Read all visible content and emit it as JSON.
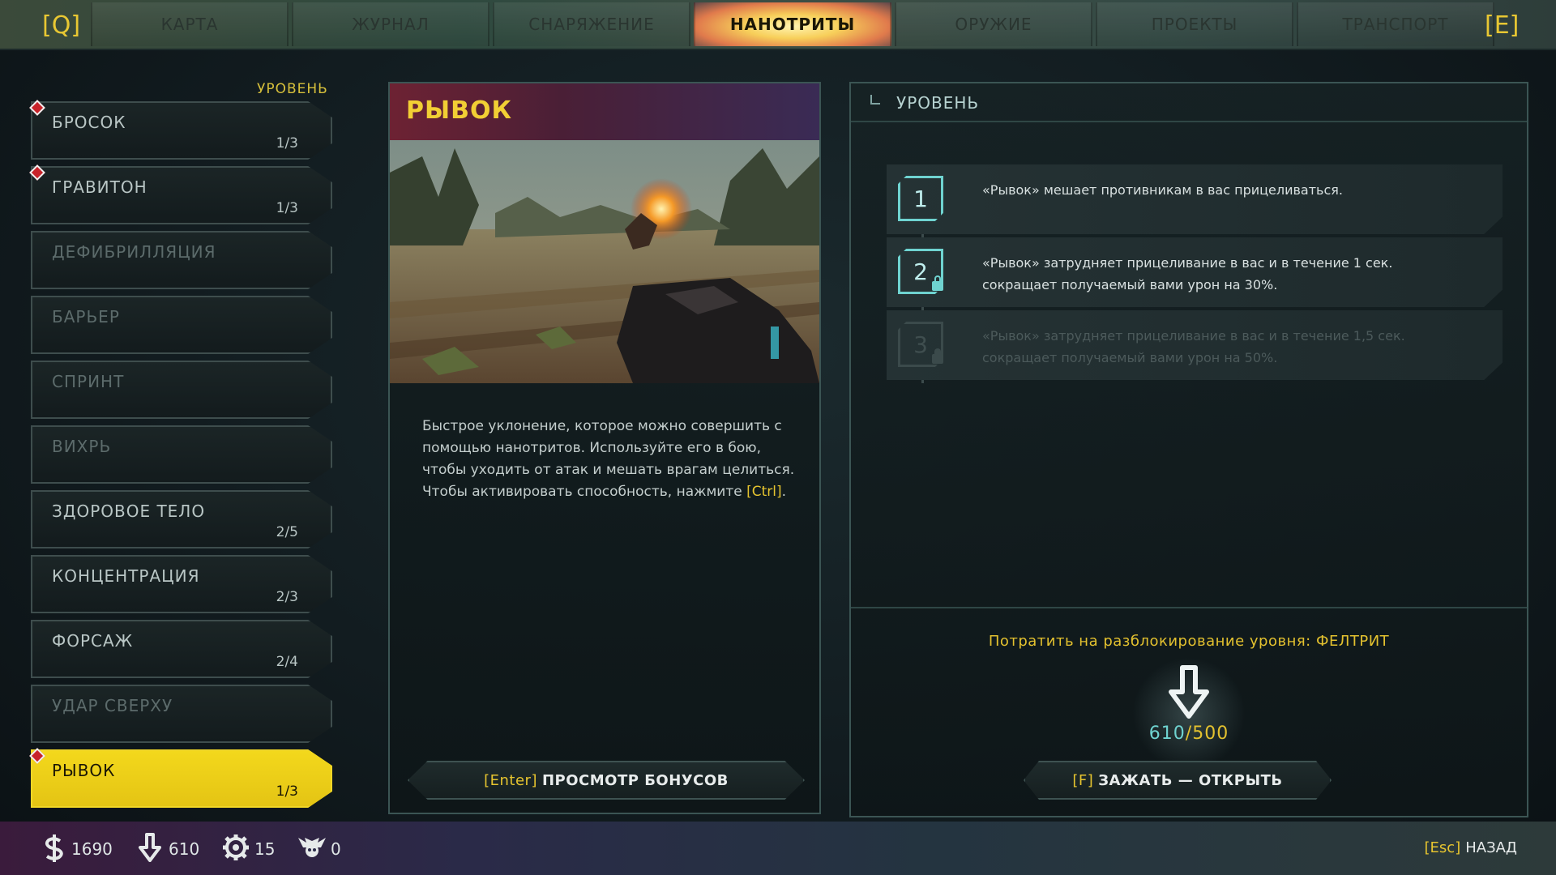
{
  "topbar": {
    "left_key": "[Q]",
    "right_key": "[E]",
    "tabs": [
      {
        "label": "КАРТА"
      },
      {
        "label": "ЖУРНАЛ"
      },
      {
        "label": "СНАРЯЖЕНИЕ"
      },
      {
        "label": "НАНОТРИТЫ",
        "active": true
      },
      {
        "label": "ОРУЖИЕ"
      },
      {
        "label": "ПРОЕКТЫ"
      },
      {
        "label": "ТРАНСПОРТ"
      }
    ]
  },
  "skills": {
    "header": "УРОВЕНЬ",
    "items": [
      {
        "name": "БРОСОК",
        "level": "1/3",
        "marker": true
      },
      {
        "name": "ГРАВИТОН",
        "level": "1/3",
        "marker": true
      },
      {
        "name": "ДЕФИБРИЛЛЯЦИЯ",
        "level": ""
      },
      {
        "name": "БАРЬЕР",
        "level": ""
      },
      {
        "name": "СПРИНТ",
        "level": ""
      },
      {
        "name": "ВИХРЬ",
        "level": ""
      },
      {
        "name": "ЗДОРОВОЕ ТЕЛО",
        "level": "2/5"
      },
      {
        "name": "КОНЦЕНТРАЦИЯ",
        "level": "2/3"
      },
      {
        "name": "ФОРСАЖ",
        "level": "2/4"
      },
      {
        "name": "УДАР СВЕРХУ",
        "level": ""
      },
      {
        "name": "РЫВОК",
        "level": "1/3",
        "marker": true,
        "active": true
      }
    ]
  },
  "detail": {
    "title": "РЫВОК",
    "description_part1": "Быстрое уклонение, которое можно совершить с помощью нанотритов. Используйте его в бою, чтобы уходить от атак и мешать врагам целиться. Чтобы активировать способность, нажмите ",
    "description_key": "[Ctrl]",
    "description_end": ".",
    "button_key": "[Enter]",
    "button_label": "ПРОСМОТР БОНУСОВ"
  },
  "levels": {
    "title": "УРОВЕНЬ",
    "tiers": [
      {
        "num": "1",
        "text": "«Рывок» мешает противникам в вас прицеливаться.",
        "locked": false,
        "dim": false
      },
      {
        "num": "2",
        "text": "«Рывок» затрудняет прицеливание в вас и в течение 1 сек. сокращает получаемый вами урон на 30%.",
        "locked": true,
        "dim": false
      },
      {
        "num": "3",
        "text": "«Рывок» затрудняет прицеливание в вас и в течение 1,5 сек. сокращает получаемый вами урон на 50%.",
        "locked": true,
        "dim": true
      }
    ],
    "spend_label": "Потратить на разблокирование уровня: ФЕЛТРИТ",
    "cost_have": "610",
    "cost_need": "/500",
    "button_key": "[F]",
    "button_label": "ЗАЖАТЬ — ОТКРЫТЬ"
  },
  "resources": {
    "money": "1690",
    "feltrite": "610",
    "parts": "15",
    "skulls": "0"
  },
  "footer": {
    "back_key": "[Esc]",
    "back_label": "НАЗАД"
  },
  "colors": {
    "accent": "#e6c42f",
    "teal": "#6fd3d0",
    "panel_border": "#3b5554"
  }
}
